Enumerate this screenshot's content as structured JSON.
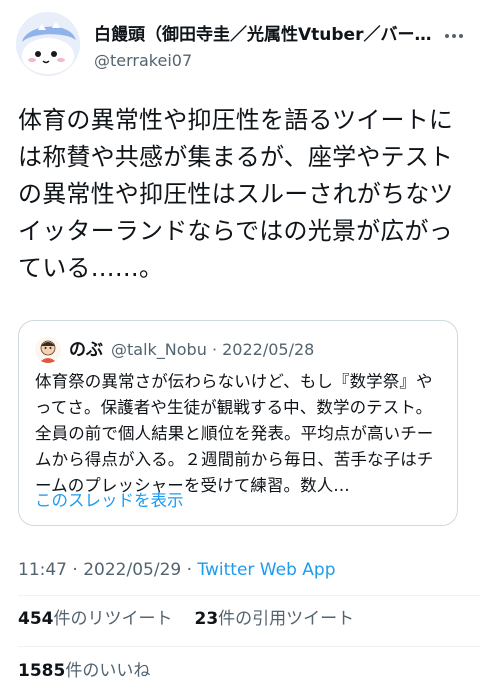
{
  "author": {
    "display_name": "白饅頭（御田寺圭／光属性Vtuber／バーチャル・メンヘラ・…",
    "handle": "@terrakei07"
  },
  "tweet": {
    "text": "体育の異常性や抑圧性を語るツイートには称賛や共感が集まるが、座学やテストの異常性や抑圧性はスルーされがちなツイッターランドならではの光景が広がっている……。"
  },
  "quote": {
    "name": "のぶ",
    "handle": "@talk_Nobu",
    "separator": "·",
    "date": "2022/05/28",
    "text": "体育祭の異常さが伝わらないけど、もし『数学祭』やってさ。保護者や生徒が観戦する中、数学のテスト。全員の前で個人結果と順位を発表。平均点が高いチームから得点が入る。２週間前から毎日、苦手な子はチームのプレッシャーを受けて練習。数人…",
    "thread_link": "このスレッドを表示"
  },
  "meta": {
    "time": "11:47",
    "separator": "·",
    "date": "2022/05/29",
    "source": "Twitter Web App"
  },
  "stats": {
    "retweets_count": "454",
    "retweets_label": "件のリツイート",
    "quotes_count": "23",
    "quotes_label": "件の引用ツイート",
    "likes_count": "1585",
    "likes_label": "件のいいね"
  },
  "colors": {
    "link": "#1d9bf0",
    "secondary_text": "#536471",
    "border": "#cfd9de"
  },
  "icons": {
    "avatar": "avatar-mascot-icon",
    "quote_avatar": "avatar-person-icon",
    "more": "more-icon"
  }
}
